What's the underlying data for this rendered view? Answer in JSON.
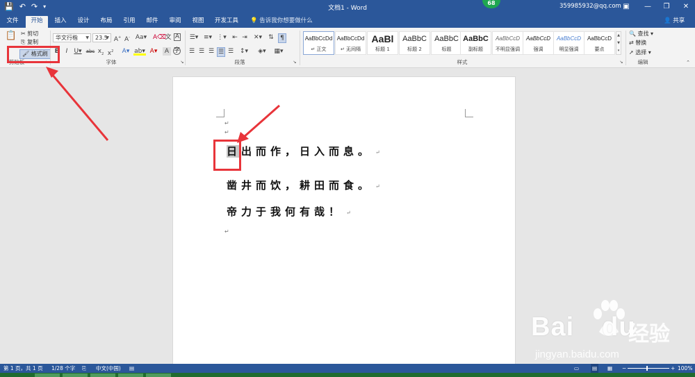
{
  "window": {
    "title": "文档1 - Word",
    "badge": "68",
    "account": "359985932@qq.com",
    "share": "共享"
  },
  "tabs": [
    "文件",
    "开始",
    "插入",
    "设计",
    "布局",
    "引用",
    "邮件",
    "审阅",
    "视图",
    "开发工具"
  ],
  "tell_me": "告诉我你想要做什么",
  "clipboard": {
    "paste": "粘贴",
    "cut": "剪切",
    "copy": "复制",
    "format_painter": "格式刷",
    "label": "剪贴板"
  },
  "font": {
    "name": "华文行楷",
    "size": "23.5",
    "label": "字体"
  },
  "paragraph": {
    "label": "段落"
  },
  "styles": {
    "label": "样式",
    "items": [
      {
        "sample": "AaBbCcDd",
        "name": "↵ 正文"
      },
      {
        "sample": "AaBbCcDd",
        "name": "↵ 无间隔"
      },
      {
        "sample": "AaBl",
        "name": "标题 1"
      },
      {
        "sample": "AaBbC",
        "name": "标题 2"
      },
      {
        "sample": "AaBbC",
        "name": "标题"
      },
      {
        "sample": "AaBbC",
        "name": "副标题"
      },
      {
        "sample": "AaBbCcD",
        "name": "不明显强调"
      },
      {
        "sample": "AaBbCcD",
        "name": "强调"
      },
      {
        "sample": "AaBbCcD",
        "name": "明显强调"
      },
      {
        "sample": "AaBbCcD",
        "name": "要点"
      }
    ]
  },
  "editing": {
    "find": "查找",
    "replace": "替换",
    "select": "选择",
    "label": "编辑"
  },
  "document": {
    "lines": [
      {
        "first": "日",
        "rest": "出而作，日入而息。"
      },
      {
        "first": "",
        "rest": "凿井而饮，耕田而食。"
      },
      {
        "first": "",
        "rest": "帝力于我何有哉！"
      }
    ],
    "para_mark": "↵"
  },
  "status": {
    "page": "第 1 页，共 1 页",
    "words": "1/28 个字",
    "lang": "中文(中国)",
    "zoom": "100%"
  },
  "watermark": {
    "brand": "Bai",
    "brand2": "du",
    "cn": "经验",
    "url": "jingyan.baidu.com"
  },
  "colors": {
    "accent": "#2b579a",
    "annotation": "#e8343a"
  }
}
